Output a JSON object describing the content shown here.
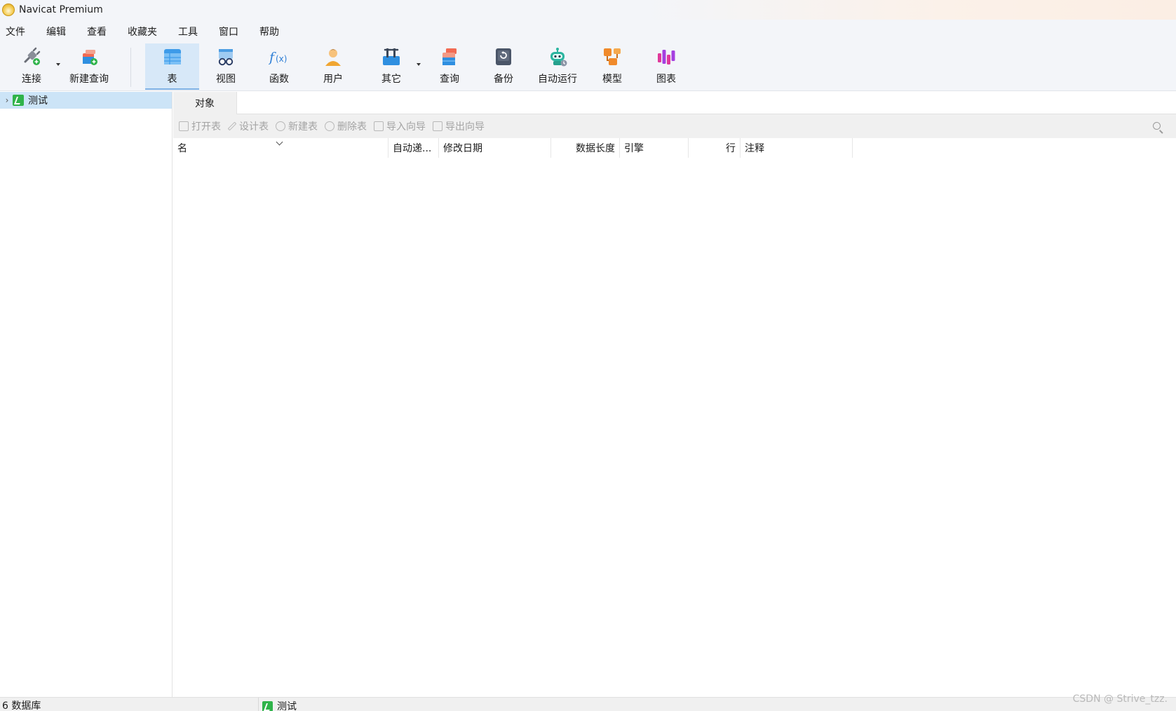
{
  "window": {
    "title": "Navicat Premium"
  },
  "menu": [
    "文件",
    "编辑",
    "查看",
    "收藏夹",
    "工具",
    "窗口",
    "帮助"
  ],
  "toolbar": {
    "connect": "连接",
    "new_query": "新建查询",
    "table": "表",
    "view": "视图",
    "function": "函数",
    "user": "用户",
    "other": "其它",
    "query": "查询",
    "backup": "备份",
    "auto_run": "自动运行",
    "model": "模型",
    "chart": "图表"
  },
  "sidebar": {
    "items": [
      {
        "label": "测试",
        "expanded": false,
        "selected": true
      }
    ]
  },
  "tabs": {
    "objects": "对象"
  },
  "object_toolbar": {
    "open_table": "打开表",
    "design_table": "设计表",
    "new_table": "新建表",
    "delete_table": "删除表",
    "import_wizard": "导入向导",
    "export_wizard": "导出向导"
  },
  "table": {
    "columns": [
      "名",
      "自动递...",
      "修改日期",
      "数据长度",
      "引擎",
      "行",
      "注释"
    ],
    "rows": []
  },
  "status": {
    "db_count": "6 数据库",
    "current_db": "测试",
    "watermark": "CSDN @ Strive_tzz."
  },
  "colors": {
    "accent": "#2fb34a",
    "selection": "#cce4f7",
    "active_tool": "#d7e8f8"
  }
}
